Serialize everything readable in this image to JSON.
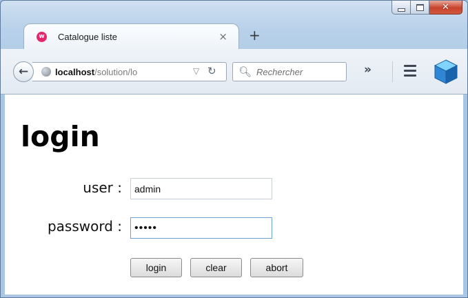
{
  "window": {
    "minimize_icon": "minimize-icon",
    "maximize_icon": "maximize-icon",
    "close_glyph": "✕"
  },
  "tab": {
    "favicon_letter": "w",
    "title": "Catalogue liste",
    "close_glyph": "×"
  },
  "new_tab_glyph": "+",
  "nav": {
    "back_glyph": "←",
    "url_host": "localhost",
    "url_path": "/solution/lo",
    "dropdown_glyph": "▽",
    "reload_glyph": "C",
    "search_placeholder": "Rechercher",
    "overflow_glyph": "»"
  },
  "page": {
    "title": "login",
    "user_label": "user :",
    "user_value": "admin",
    "password_label": "password :",
    "password_value": "admin",
    "buttons": {
      "login": "login",
      "clear": "clear",
      "abort": "abort"
    }
  },
  "colors": {
    "accent": "#6f9ed0",
    "favicon": "#e6266a",
    "close_button": "#c7432c"
  }
}
